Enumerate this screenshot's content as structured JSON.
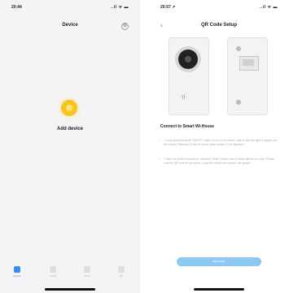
{
  "left": {
    "status": {
      "time": "20:44",
      "signal": "..il ᯤ ▬"
    },
    "title": "Device",
    "add_icon": "⊕",
    "add_device_label": "Add device",
    "colors": {
      "accent": "#f3c61e"
    },
    "tabs": [
      {
        "label": "Device",
        "icon": "home-icon"
      },
      {
        "label": "Smart",
        "icon": "smart-icon"
      },
      {
        "label": "Store",
        "icon": "store-icon"
      },
      {
        "label": "Me",
        "icon": "profile-icon"
      }
    ]
  },
  "right": {
    "status": {
      "time": "20:57 ↗",
      "signal": "..il ᯤ ▬"
    },
    "back_icon": "‹",
    "title": "QR Code Setup",
    "device_dots": "·||·",
    "heading": "Connect to Smart Wi-House",
    "steps": [
      {
        "number": "1",
        "text": "1. Long-press the small \"ON/OFF\" button to turn on the device, wait for the blue light to appear and the camera \"Welcome to use the smart home camera\" to be displayed."
      },
      {
        "number": "2",
        "text": "2. After the device is turned on, press the \"Reset\" button once to reset; wait for the voice \"Please scan the QR code on the screen, using the screen with camera\" will appear."
      }
    ],
    "next_label": "Next step",
    "colors": {
      "button": "#8cc8ef"
    }
  }
}
